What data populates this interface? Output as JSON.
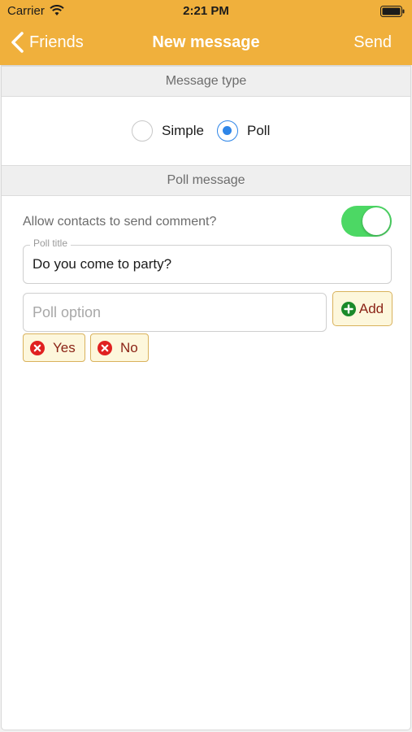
{
  "status_bar": {
    "carrier": "Carrier",
    "time": "2:21 PM"
  },
  "nav": {
    "back_label": "Friends",
    "title": "New message",
    "send_label": "Send"
  },
  "message_type": {
    "header": "Message type",
    "options": [
      {
        "label": "Simple",
        "selected": false
      },
      {
        "label": "Poll",
        "selected": true
      }
    ]
  },
  "poll": {
    "header": "Poll message",
    "allow_comments_label": "Allow contacts to send comment?",
    "allow_comments_on": true,
    "title_legend": "Poll title",
    "title_value": "Do you come to party?",
    "option_placeholder": "Poll option",
    "add_label": "Add",
    "options": [
      "Yes",
      "No"
    ]
  },
  "colors": {
    "nav_bg": "#f0b03c",
    "radio_accent": "#2f86e8",
    "toggle_on": "#4cd864",
    "chip_bg": "#fdf7dc",
    "chip_border": "#d9b25c",
    "remove_icon": "#e02020",
    "add_icon": "#1a8a2a"
  },
  "icons": {
    "wifi": "wifi-icon",
    "battery": "battery-icon",
    "back": "chevron-left-icon",
    "add": "plus-circle-icon",
    "remove": "x-circle-icon"
  }
}
